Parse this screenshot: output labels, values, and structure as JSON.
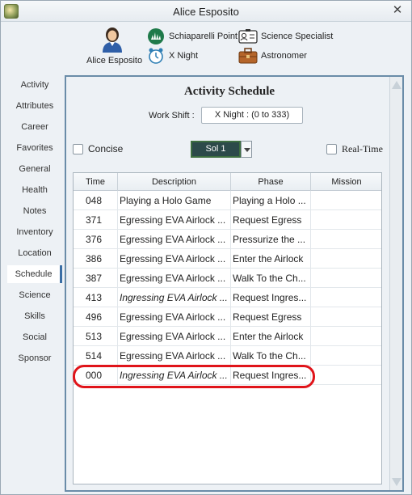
{
  "window": {
    "title": "Alice Esposito"
  },
  "header": {
    "person_name": "Alice Esposito",
    "settlement": "Schiaparelli Point",
    "job": "Science Specialist",
    "shift": "X Night",
    "role": "Astronomer"
  },
  "sidebar": {
    "items": [
      {
        "label": "Activity"
      },
      {
        "label": "Attributes"
      },
      {
        "label": "Career"
      },
      {
        "label": "Favorites"
      },
      {
        "label": "General"
      },
      {
        "label": "Health"
      },
      {
        "label": "Notes"
      },
      {
        "label": "Inventory"
      },
      {
        "label": "Location"
      },
      {
        "label": "Schedule"
      },
      {
        "label": "Science"
      },
      {
        "label": "Skills"
      },
      {
        "label": "Social"
      },
      {
        "label": "Sponsor"
      }
    ],
    "active": "Schedule"
  },
  "panel": {
    "title": "Activity Schedule",
    "shift_label": "Work Shift :",
    "shift_value": "X Night : (0 to 333)",
    "concise_label": "Concise",
    "sol_value": "Sol 1",
    "realtime_label": "Real-Time"
  },
  "table": {
    "headers": {
      "time": "Time",
      "description": "Description",
      "phase": "Phase",
      "mission": "Mission"
    },
    "rows": [
      {
        "time": "048",
        "description": "Playing a Holo Game",
        "phase": "Playing a Holo ...",
        "mission": ""
      },
      {
        "time": "371",
        "description": "Egressing EVA Airlock ...",
        "phase": "Request Egress",
        "mission": ""
      },
      {
        "time": "376",
        "description": "Egressing EVA Airlock ...",
        "phase": "Pressurize the ...",
        "mission": ""
      },
      {
        "time": "386",
        "description": "Egressing EVA Airlock ...",
        "phase": "Enter the Airlock",
        "mission": ""
      },
      {
        "time": "387",
        "description": "Egressing EVA Airlock ...",
        "phase": "Walk To the Ch...",
        "mission": ""
      },
      {
        "time": "413",
        "description": "Ingressing EVA Airlock ...",
        "phase": "Request Ingres...",
        "mission": ""
      },
      {
        "time": "496",
        "description": "Egressing EVA Airlock ...",
        "phase": "Request Egress",
        "mission": ""
      },
      {
        "time": "513",
        "description": "Egressing EVA Airlock ...",
        "phase": "Enter the Airlock",
        "mission": ""
      },
      {
        "time": "514",
        "description": "Egressing EVA Airlock ...",
        "phase": "Walk To the Ch...",
        "mission": ""
      },
      {
        "time": "000",
        "description": "Ingressing EVA Airlock ...",
        "phase": "Request Ingres...",
        "mission": ""
      }
    ]
  },
  "colors": {
    "highlight": "#e0141a",
    "accent": "#3a6ea5",
    "sol_bg": "#2c4a4a"
  }
}
